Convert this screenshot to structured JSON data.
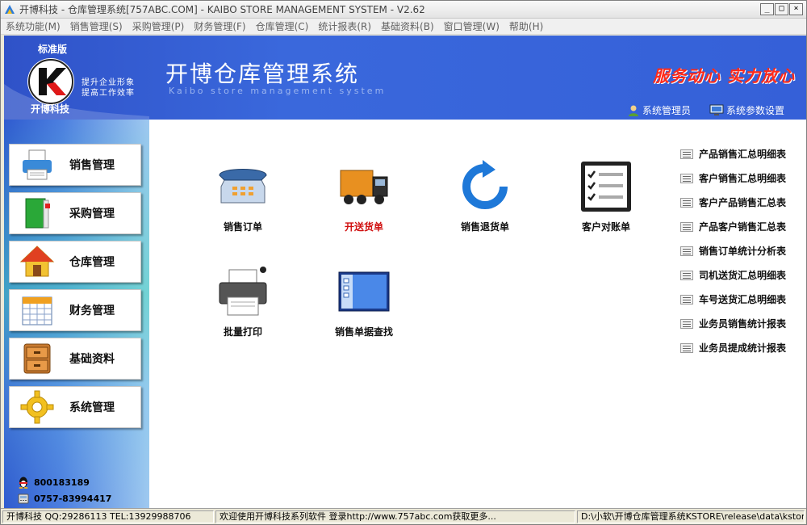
{
  "window": {
    "title": "开博科技 - 仓库管理系统[757ABC.COM] - KAIBO STORE MANAGEMENT SYSTEM - V2.62",
    "min_glyph": "_",
    "max_glyph": "□",
    "close_glyph": "×"
  },
  "menu": [
    "系统功能(M)",
    "销售管理(S)",
    "采购管理(P)",
    "财务管理(F)",
    "仓库管理(C)",
    "统计报表(R)",
    "基础资料(B)",
    "窗口管理(W)",
    "帮助(H)"
  ],
  "banner": {
    "edition": "标准版",
    "brand": "开博科技",
    "slogan_line1": "提升企业形象",
    "slogan_line2": "提高工作效率",
    "system_title": "开博仓库管理系统",
    "system_subtitle": "Kaibo store management system",
    "tagline": "服务动心 实力放心",
    "user_link": "系统管理员",
    "settings_link": "系统参数设置"
  },
  "nav": [
    {
      "label": "销售管理",
      "icon": "printer-icon"
    },
    {
      "label": "采购管理",
      "icon": "book-icon"
    },
    {
      "label": "仓库管理",
      "icon": "house-icon"
    },
    {
      "label": "财务管理",
      "icon": "calendar-icon"
    },
    {
      "label": "基础资料",
      "icon": "cabinet-icon"
    },
    {
      "label": "系统管理",
      "icon": "gear-icon"
    }
  ],
  "contacts": {
    "qq": "800183189",
    "phone": "0757-83994417"
  },
  "tiles": [
    {
      "label": "销售订单",
      "icon": "telephone-icon"
    },
    {
      "label": "开送货单",
      "icon": "truck-icon",
      "highlight": true
    },
    {
      "label": "销售退货单",
      "icon": "refresh-arrow-icon"
    },
    {
      "label": "客户对账单",
      "icon": "checklist-icon"
    },
    {
      "label": "批量打印",
      "icon": "printer-icon"
    },
    {
      "label": "销售单据查找",
      "icon": "window-icon"
    }
  ],
  "reports": [
    "产品销售汇总明细表",
    "客户销售汇总明细表",
    "客户产品销售汇总表",
    "产品客户销售汇总表",
    "销售订单统计分析表",
    "司机送货汇总明细表",
    "车号送货汇总明细表",
    "业务员销售统计报表",
    "业务员提成统计报表"
  ],
  "status": {
    "company": "开博科技 QQ:29286113 TEL:13929988706",
    "welcome": "欢迎使用开博科技系列软件  登录http://www.757abc.com获取更多...",
    "path": "D:\\小软\\开博仓库管理系统KSTORE\\release\\data\\kstore"
  },
  "colors": {
    "banner_blue": "#3560d8",
    "tagline_red": "#ff2a1a",
    "highlight_red": "#d01010"
  }
}
